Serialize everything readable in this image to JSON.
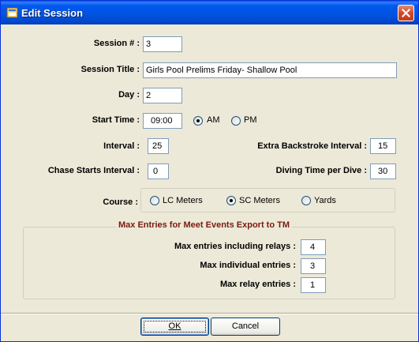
{
  "window": {
    "title": "Edit Session"
  },
  "fields": {
    "session_num": {
      "label": "Session # :",
      "value": "3"
    },
    "session_title": {
      "label": "Session Title :",
      "value": "Girls Pool Prelims Friday- Shallow Pool"
    },
    "day": {
      "label": "Day :",
      "value": "2"
    },
    "start_time": {
      "label": "Start Time :",
      "value": "09:00"
    },
    "interval": {
      "label": "Interval :",
      "value": "25"
    },
    "extra_backstroke": {
      "label": "Extra Backstroke Interval :",
      "value": "15"
    },
    "chase_starts": {
      "label": "Chase Starts Interval :",
      "value": "0"
    },
    "diving_time": {
      "label": "Diving Time per Dive :",
      "value": "30"
    }
  },
  "ampm": {
    "am_label": "AM",
    "pm_label": "PM",
    "selected": "AM"
  },
  "course": {
    "label": "Course :",
    "options": [
      "LC Meters",
      "SC Meters",
      "Yards"
    ],
    "selected": "SC Meters"
  },
  "max_entries": {
    "title": "Max Entries for Meet Events Export to TM",
    "incl_relays": {
      "label": "Max entries including relays :",
      "value": "4"
    },
    "individual": {
      "label": "Max individual entries :",
      "value": "3"
    },
    "relay": {
      "label": "Max relay entries :",
      "value": "1"
    }
  },
  "buttons": {
    "ok": "OK",
    "cancel": "Cancel"
  },
  "colors": {
    "titlebar": "#0054e3",
    "group_title": "#7a1a10",
    "dialog_bg": "#ece9d8"
  }
}
